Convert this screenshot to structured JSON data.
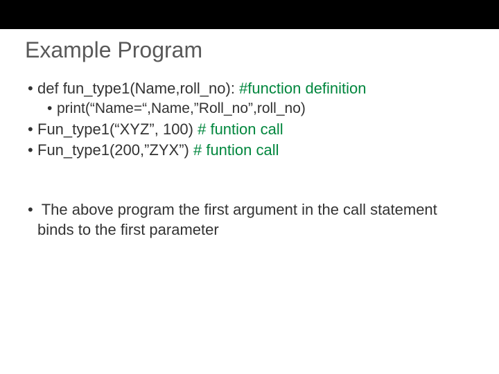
{
  "title": "Example Program",
  "lines": {
    "l1_code": "def fun_type1(Name,roll_no): ",
    "l1_comment": "#function definition",
    "l2": "print(“Name=“,Name,”Roll_no”,roll_no)",
    "l3_code": "Fun_type1(“XYZ”, 100) ",
    "l3_comment": "# funtion call",
    "l4_code": "Fun_type1(200,”ZYX”) ",
    "l4_comment": "# funtion call",
    "l5": " The above program the first argument in the call statement binds to the first parameter"
  }
}
